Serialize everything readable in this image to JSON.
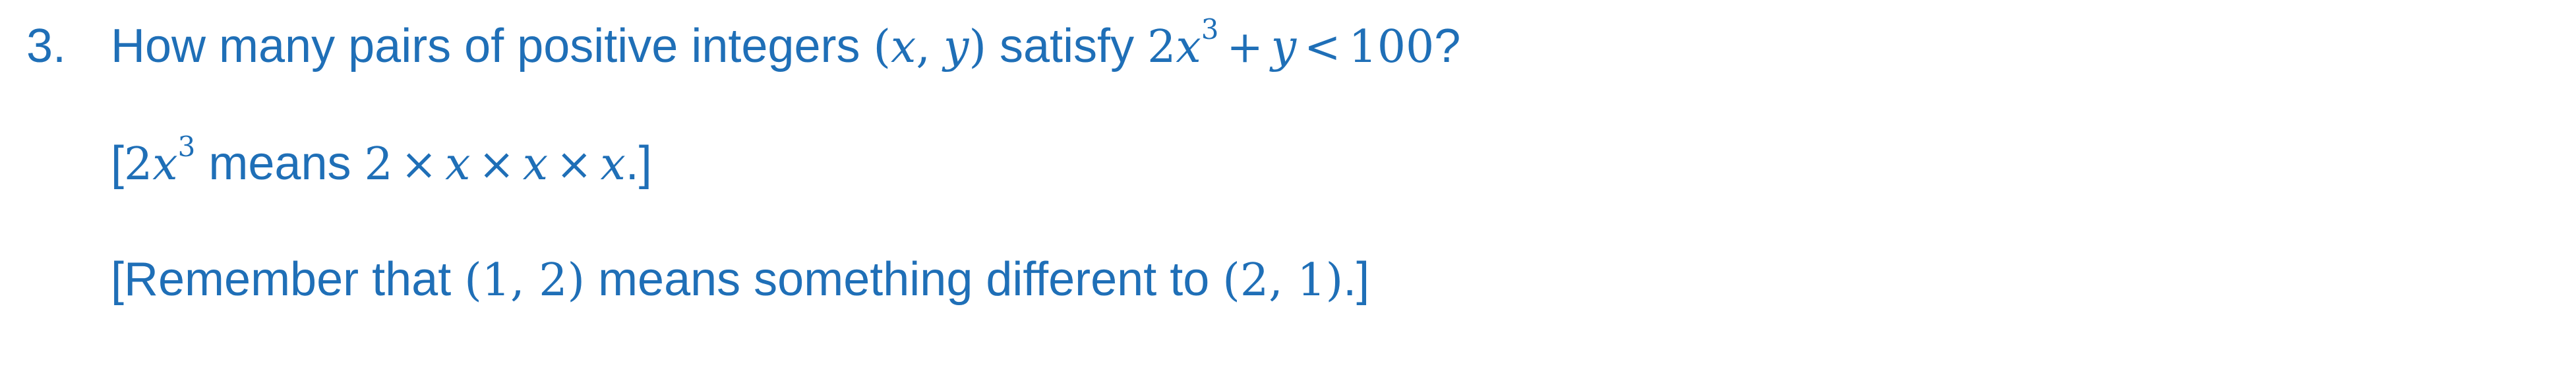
{
  "question": {
    "number": "3.",
    "line1": {
      "text_a": "How many pairs of positive integers",
      "pair_open": "(",
      "pair_x": "x",
      "pair_comma": ",",
      "pair_y": "y",
      "pair_close": ")",
      "text_b": "satisfy",
      "ineq_coef": "2",
      "ineq_var": "x",
      "ineq_exp": "3",
      "ineq_plus": "+",
      "ineq_y": "y",
      "ineq_lt": "<",
      "ineq_rhs": "100",
      "qmark": "?"
    },
    "line2": {
      "open": "[",
      "coef": "2",
      "var": "x",
      "exp": "3",
      "text": "means",
      "expr_2": "2",
      "times1": "×",
      "x1": "x",
      "times2": "×",
      "x2": "x",
      "times3": "×",
      "x3": "x",
      "close": ".]"
    },
    "line3": {
      "text_a": "[Remember that",
      "pair1": "(1, 2)",
      "text_b": "means something different to",
      "pair2": "(2, 1)",
      "close": ".]"
    }
  },
  "colors": {
    "text": "#1f6fb7",
    "background": "#ffffff"
  }
}
